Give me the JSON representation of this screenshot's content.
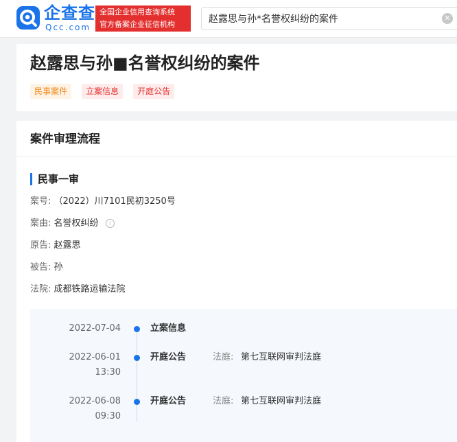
{
  "header": {
    "logo_text": "企查查",
    "logo_en": "Qcc.com",
    "slogan_line1": "全国企业信用查询系统",
    "slogan_line2": "官方备案企业征信机构",
    "search_value": "赵露思与孙*名誉权纠纷的案件"
  },
  "case": {
    "title": "赵露思与孙■名誉权纠纷的案件",
    "tags": [
      "民事案件",
      "立案信息",
      "开庭公告"
    ]
  },
  "process": {
    "section_title": "案件审理流程",
    "stage": "民事一审",
    "fields": [
      {
        "label": "案号:",
        "value": "（2022）川7101民初3250号"
      },
      {
        "label": "案由:",
        "value": "名誉权纠纷"
      },
      {
        "label": "原告:",
        "value": "赵露思"
      },
      {
        "label": "被告:",
        "value": "孙"
      },
      {
        "label": "法院:",
        "value": "成都铁路运输法院"
      }
    ],
    "timeline": [
      {
        "date": "2022-07-04",
        "time": "",
        "type": "立案信息",
        "court_label": "",
        "court": ""
      },
      {
        "date": "2022-06-01",
        "time": "13:30",
        "type": "开庭公告",
        "court_label": "法庭:",
        "court": "第七互联网审判法庭"
      },
      {
        "date": "2022-06-08",
        "time": "09:30",
        "type": "开庭公告",
        "court_label": "法庭:",
        "court": "第七互联网审判法庭"
      }
    ]
  },
  "colors": {
    "brand_blue": "#1a73e8",
    "slogan_red": "#e3302f",
    "tag_orange": "#f08a1a"
  },
  "icons": {
    "logo": "magnifier-logo-icon",
    "clear": "clear-circle-icon",
    "info": "info-circle-icon",
    "timeline_dot": "timeline-dot-icon"
  }
}
